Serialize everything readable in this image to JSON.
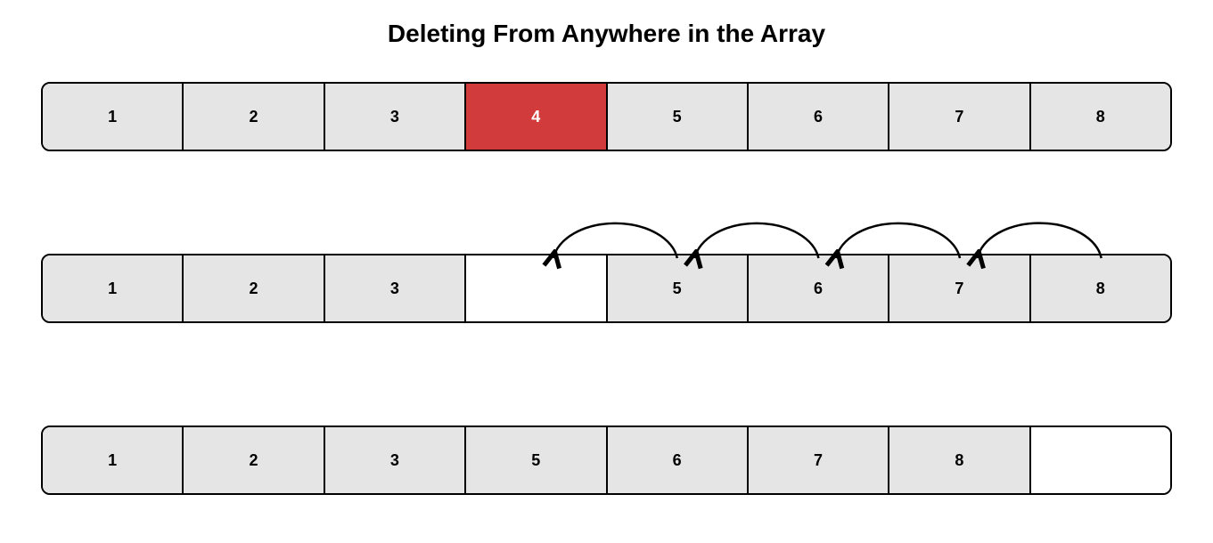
{
  "title": "Deleting From Anywhere in the Array",
  "colors": {
    "cell_bg": "#e5e5e5",
    "highlight_bg": "#d23b3b",
    "highlight_fg": "#ffffff",
    "border": "#000000"
  },
  "rows": [
    {
      "id": "row1",
      "hasArcs": false,
      "cells": [
        {
          "value": "1",
          "style": "normal"
        },
        {
          "value": "2",
          "style": "normal"
        },
        {
          "value": "3",
          "style": "normal"
        },
        {
          "value": "4",
          "style": "highlight"
        },
        {
          "value": "5",
          "style": "normal"
        },
        {
          "value": "6",
          "style": "normal"
        },
        {
          "value": "7",
          "style": "normal"
        },
        {
          "value": "8",
          "style": "normal"
        }
      ]
    },
    {
      "id": "row2",
      "hasArcs": true,
      "arcFromIndices": [
        4,
        5,
        6,
        7
      ],
      "cells": [
        {
          "value": "1",
          "style": "normal"
        },
        {
          "value": "2",
          "style": "normal"
        },
        {
          "value": "3",
          "style": "normal"
        },
        {
          "value": "",
          "style": "empty"
        },
        {
          "value": "5",
          "style": "normal"
        },
        {
          "value": "6",
          "style": "normal"
        },
        {
          "value": "7",
          "style": "normal"
        },
        {
          "value": "8",
          "style": "normal"
        }
      ]
    },
    {
      "id": "row3",
      "hasArcs": false,
      "cells": [
        {
          "value": "1",
          "style": "normal"
        },
        {
          "value": "2",
          "style": "normal"
        },
        {
          "value": "3",
          "style": "normal"
        },
        {
          "value": "5",
          "style": "normal"
        },
        {
          "value": "6",
          "style": "normal"
        },
        {
          "value": "7",
          "style": "normal"
        },
        {
          "value": "8",
          "style": "normal"
        },
        {
          "value": "",
          "style": "empty"
        }
      ]
    }
  ]
}
